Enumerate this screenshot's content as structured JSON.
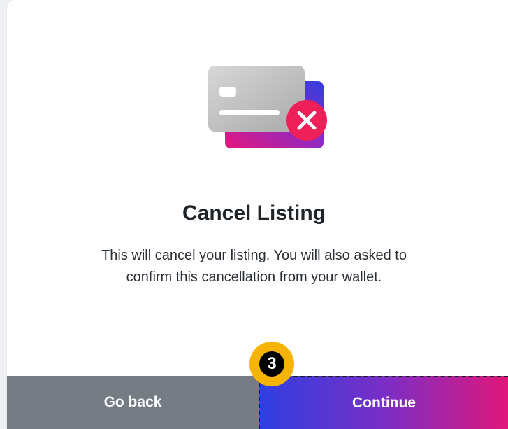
{
  "modal": {
    "illustration_icon": "cancel-card-icon",
    "title": "Cancel Listing",
    "description_line1": "This will cancel your listing. You will also asked to",
    "description_line2": "confirm this cancellation from your wallet."
  },
  "footer": {
    "go_back_label": "Go back",
    "continue_label": "Continue"
  },
  "annotation": {
    "step_number": "3"
  },
  "colors": {
    "go_back_bg": "#757c84",
    "continue_gradient_start": "#2f3fe0",
    "continue_gradient_end": "#e0177a",
    "cancel_badge": "#ef1f5a",
    "step_badge": "#f6b400"
  }
}
